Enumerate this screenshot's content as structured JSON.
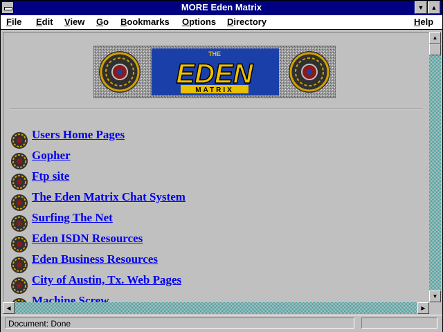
{
  "window": {
    "title": "MORE Eden Matrix"
  },
  "menu": [
    "File",
    "Edit",
    "View",
    "Go",
    "Bookmarks",
    "Options",
    "Directory",
    "Help"
  ],
  "logo": {
    "top": "THE",
    "main": "EDEN",
    "bottom": "MATRIX",
    "icon": "eden-matrix-logo-icon"
  },
  "links": [
    "Users Home Pages",
    "Gopher",
    "Ftp site",
    "The Eden Matrix Chat System",
    "Surfing The Net",
    "Eden ISDN Resources",
    "Eden Business Resources",
    "City of Austin, Tx. Web Pages",
    "Machine Screw"
  ],
  "status": {
    "text": "Document: Done"
  },
  "colors": {
    "titlebar": "#000080",
    "link": "#0000ee",
    "face": "#c0c0c0"
  }
}
